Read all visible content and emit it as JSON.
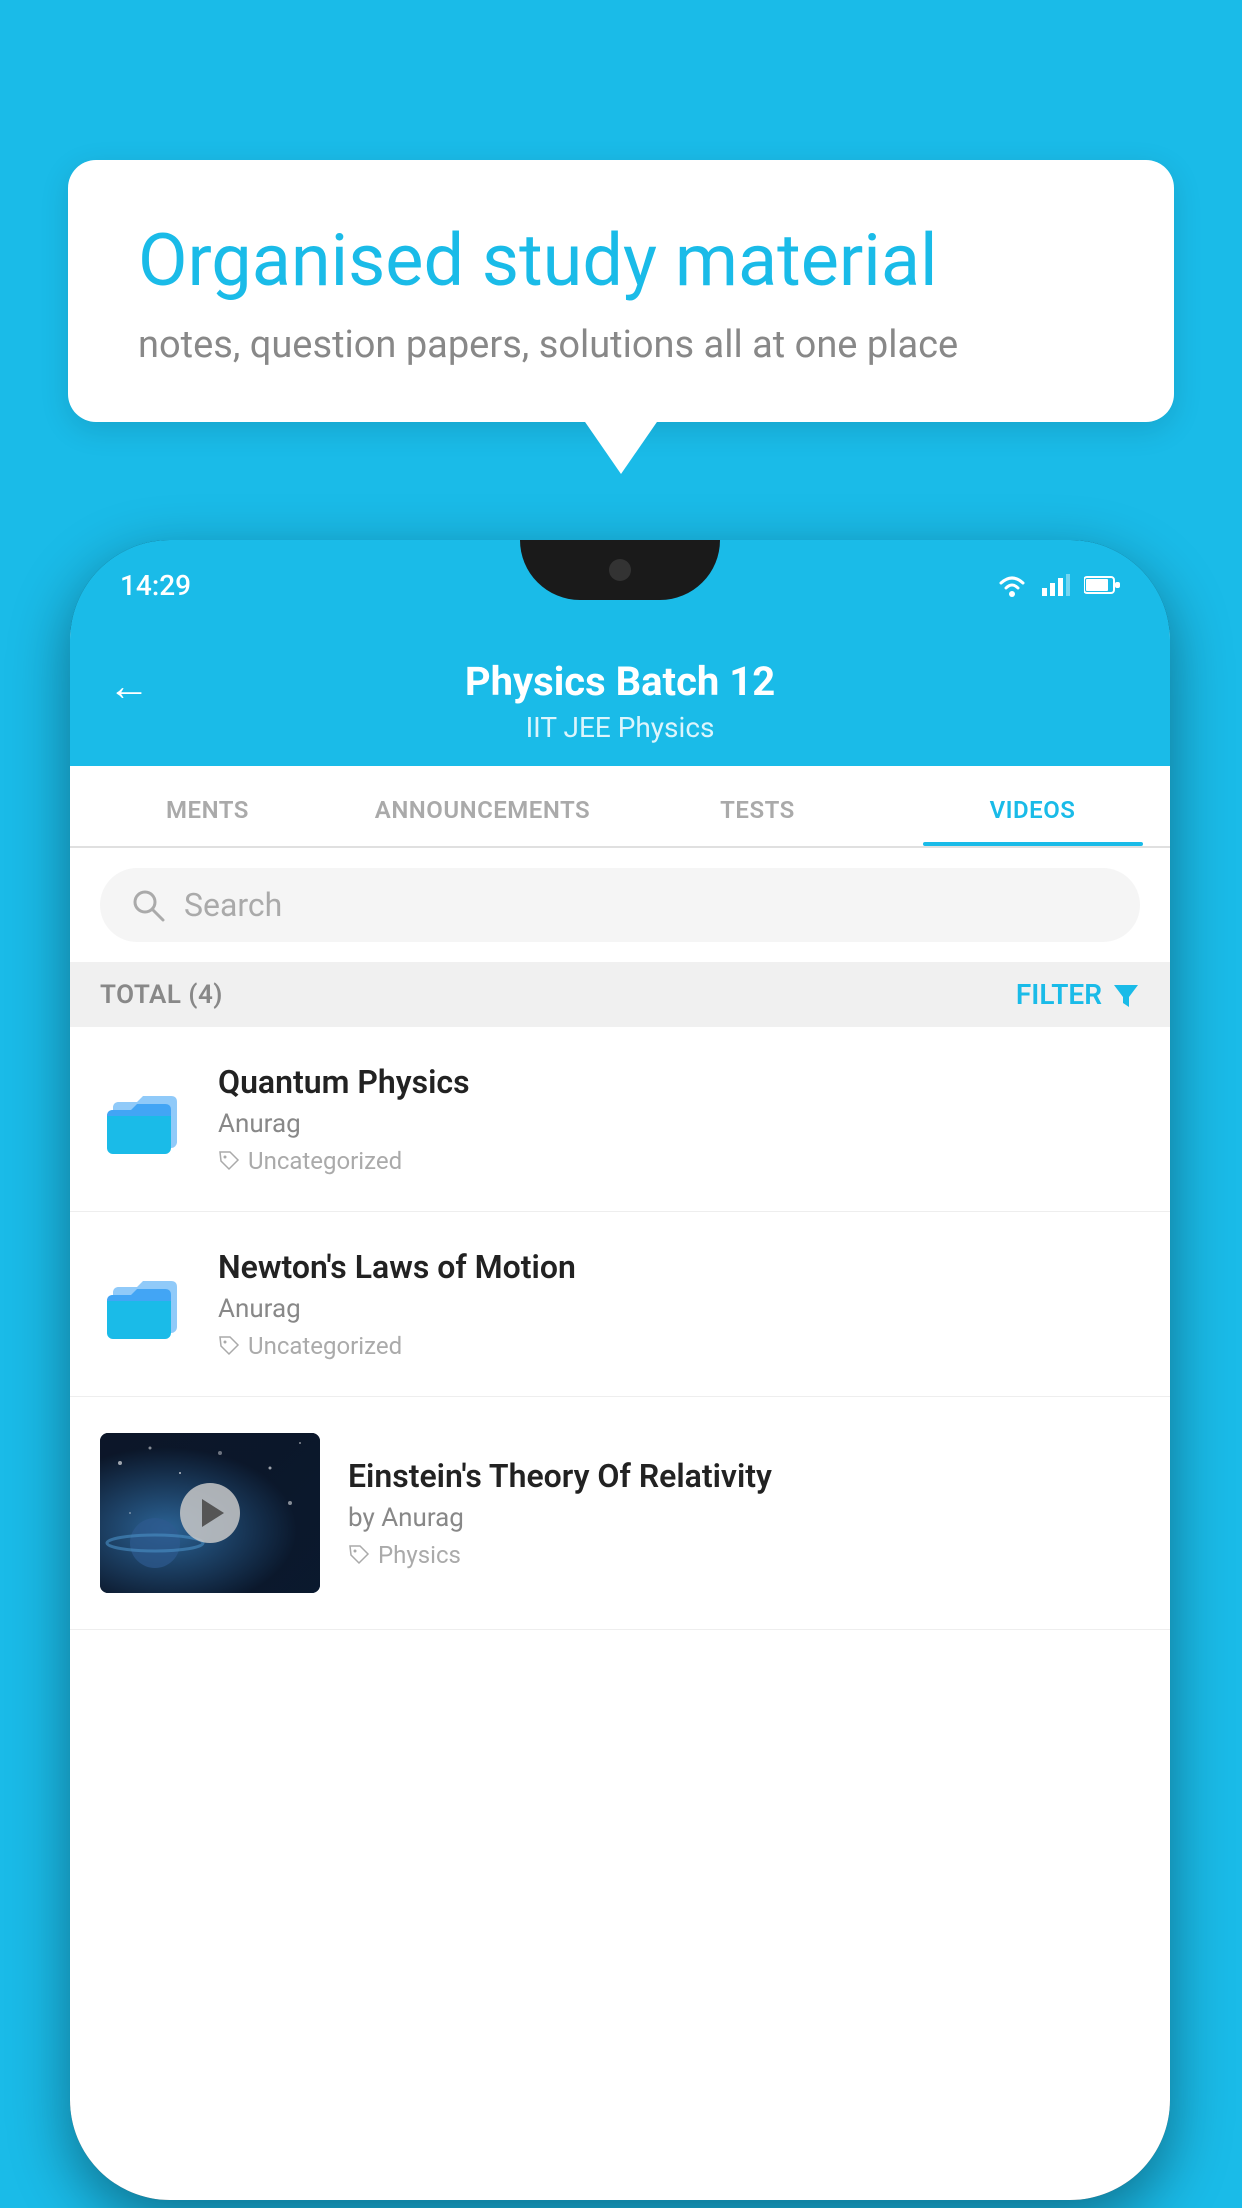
{
  "background_color": "#1ABBE8",
  "bubble": {
    "title": "Organised study material",
    "subtitle": "notes, question papers, solutions all at one place"
  },
  "phone": {
    "status_bar": {
      "time": "14:29"
    },
    "header": {
      "title": "Physics Batch 12",
      "subtitle": "IIT JEE   Physics",
      "back_label": "←"
    },
    "tabs": [
      {
        "label": "MENTS",
        "active": false
      },
      {
        "label": "ANNOUNCEMENTS",
        "active": false
      },
      {
        "label": "TESTS",
        "active": false
      },
      {
        "label": "VIDEOS",
        "active": true
      }
    ],
    "search": {
      "placeholder": "Search"
    },
    "filter_bar": {
      "total": "TOTAL (4)",
      "filter_label": "FILTER"
    },
    "videos": [
      {
        "title": "Quantum Physics",
        "author": "Anurag",
        "tag": "Uncategorized",
        "type": "folder"
      },
      {
        "title": "Newton's Laws of Motion",
        "author": "Anurag",
        "tag": "Uncategorized",
        "type": "folder"
      },
      {
        "title": "Einstein's Theory Of Relativity",
        "author": "by Anurag",
        "tag": "Physics",
        "type": "video"
      }
    ]
  }
}
